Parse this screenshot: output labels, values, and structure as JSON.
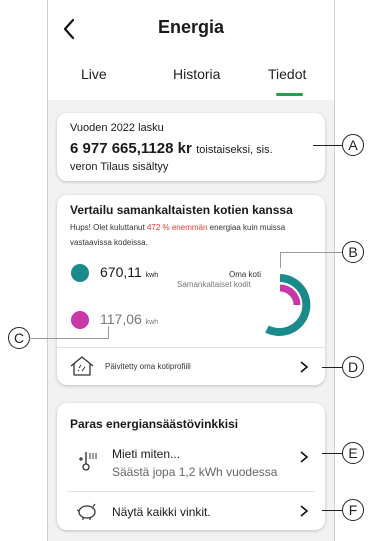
{
  "header": {
    "title": "Energia",
    "tabs": [
      {
        "label": "Live"
      },
      {
        "label": "Historia"
      },
      {
        "label": "Tiedot"
      }
    ],
    "active_tab_color": "#25a04a"
  },
  "bill": {
    "title": "Vuoden 2022 lasku",
    "amount": "6 977 665,1128 kr",
    "suffix": "toistaiseksi, sis.",
    "note": "veron Tilaus sisältyy"
  },
  "compare": {
    "title": "Vertailu samankaltaisten kotien kanssa",
    "msg_prefix": "Hups! Olet kuluttanut ",
    "msg_highlight": "472 % enemmän",
    "msg_suffix": " energiaa kuin muissa",
    "msg_line2": "vastaavissa kodeissa.",
    "own_value": "670,11",
    "own_unit": "kwh",
    "similar_value": "117,06",
    "similar_unit": "kwh",
    "own_label": "Oma koti",
    "similar_label": "Samankaltaiset kodit",
    "own_color": "#1a8a8a",
    "similar_color": "#c838a8",
    "highlight_color": "#e53935",
    "profile_link": "Päivitetty oma kotiprofiili"
  },
  "tips": {
    "title": "Paras energiansäästövinkkisi",
    "tip_title": "Mieti miten...",
    "tip_sub": "Säästä jopa 1,2 kWh vuodessa",
    "all_tips": "Näytä kaikki vinkit."
  },
  "callouts": [
    "A",
    "B",
    "C",
    "D",
    "E",
    "F"
  ]
}
